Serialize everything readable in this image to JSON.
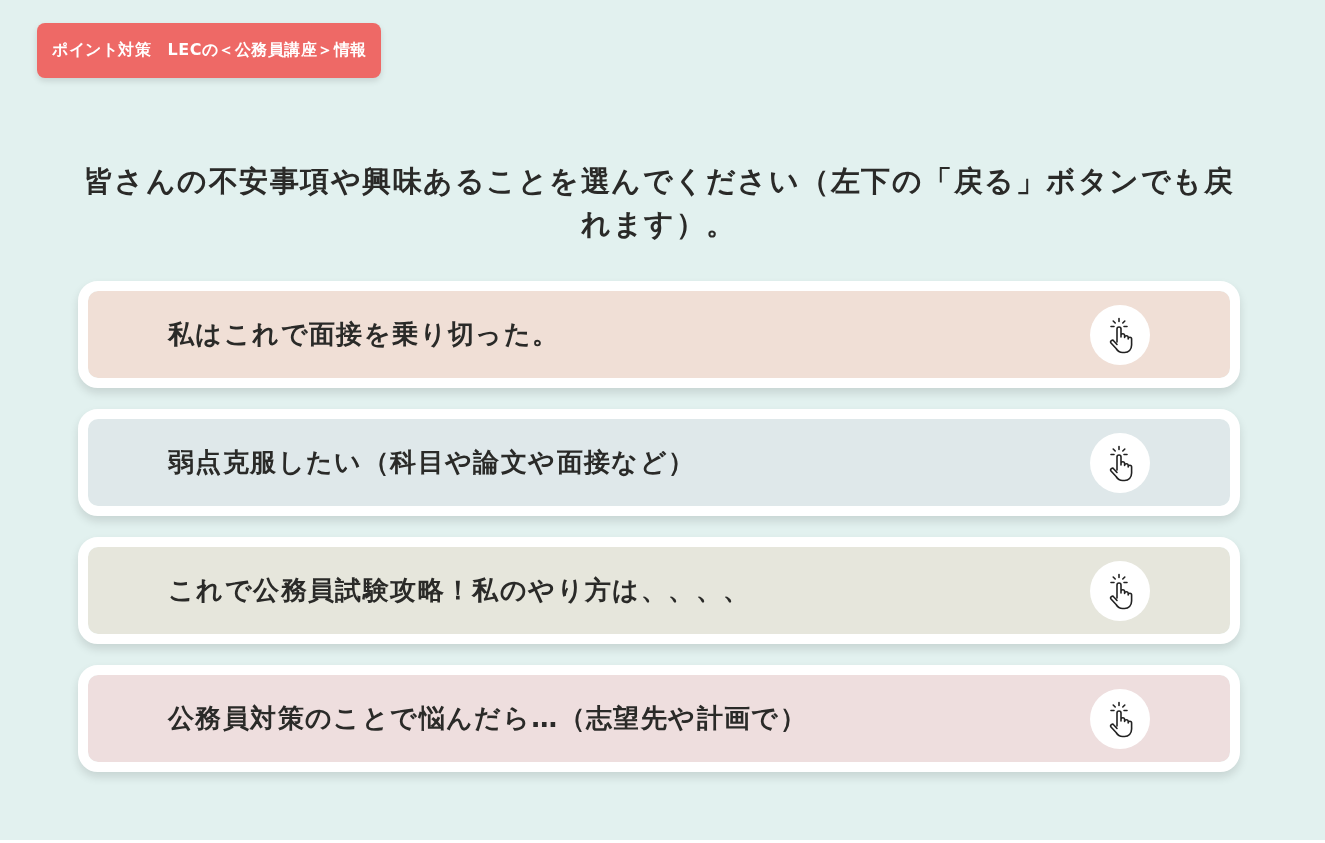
{
  "header": {
    "tag": "ポイント対策　LECの＜公務員講座＞情報"
  },
  "prompt": "皆さんの不安事項や興味あることを選んでください（左下の「戻る」ボタンでも戻れます）。",
  "options": [
    {
      "label": "私はこれで面接を乗り切った。",
      "color": "#f0dfd6"
    },
    {
      "label": "弱点克服したい（科目や論文や面接など）",
      "color": "#dfe8ea"
    },
    {
      "label": "これで公務員試験攻略！私のやり方は、、、、",
      "color": "#e6e6dc"
    },
    {
      "label": "公務員対策のことで悩んだら…（志望先や計画で）",
      "color": "#eedede"
    }
  ]
}
